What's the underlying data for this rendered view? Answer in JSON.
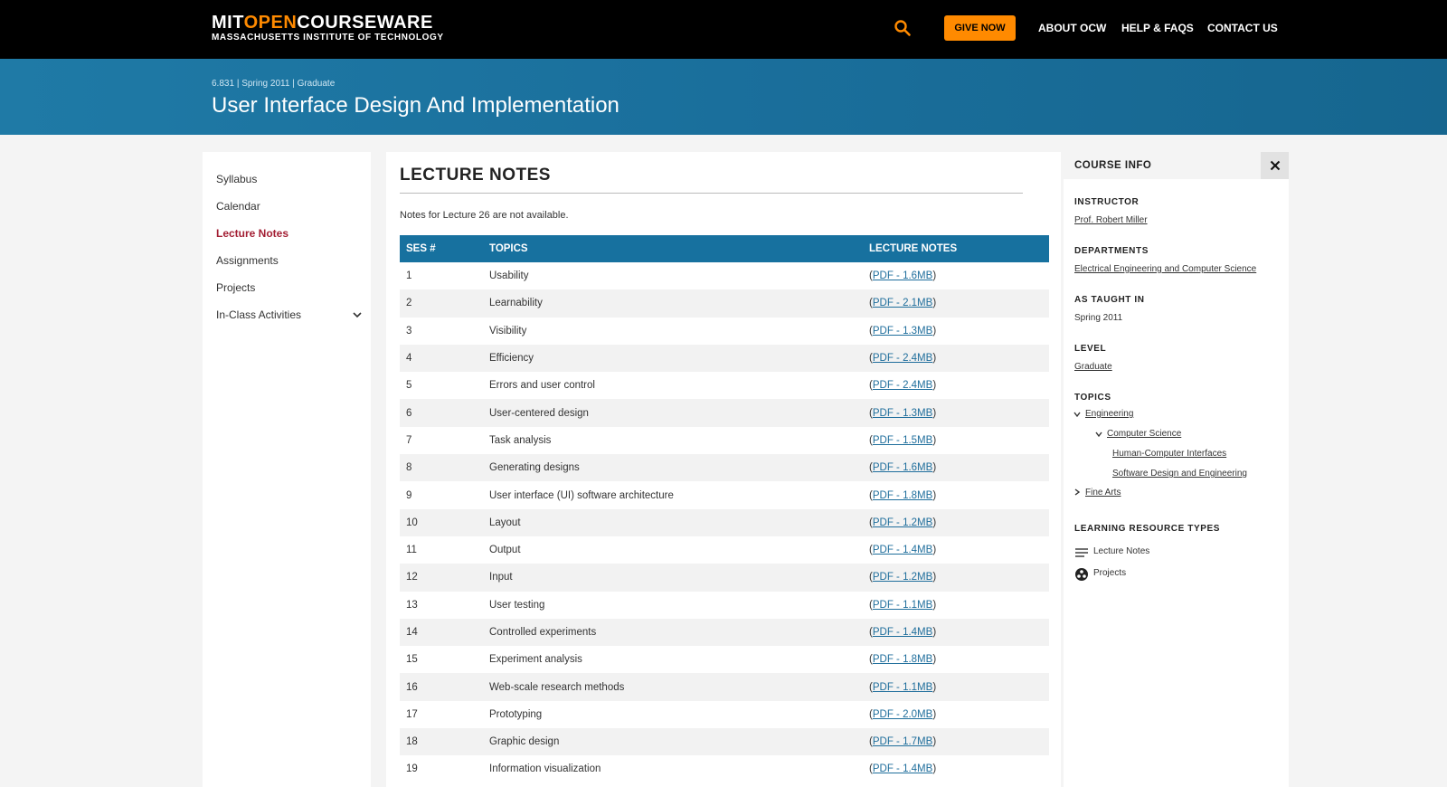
{
  "header": {
    "logo_part1": "MIT",
    "logo_part2": "OPEN",
    "logo_part3": "COURSEWARE",
    "logo_sub": "MASSACHUSETTS INSTITUTE OF TECHNOLOGY",
    "give_now": "GIVE NOW",
    "nav": [
      "ABOUT OCW",
      "HELP & FAQS",
      "CONTACT US"
    ]
  },
  "banner": {
    "number": "6.831",
    "term": "Spring 2011",
    "level": "Graduate",
    "separator": "|",
    "title": "User Interface Design And Implementation"
  },
  "leftnav": {
    "items": [
      "Syllabus",
      "Calendar",
      "Lecture Notes",
      "Assignments",
      "Projects",
      "In-Class Activities"
    ],
    "active": "Lecture Notes"
  },
  "main": {
    "title": "LECTURE NOTES",
    "note": "Notes for Lecture 26 are not available.",
    "columns": [
      "SES #",
      "TOPICS",
      "LECTURE NOTES"
    ],
    "rows": [
      {
        "ses": "1",
        "topic": "Usability",
        "link": "PDF - 1.6MB"
      },
      {
        "ses": "2",
        "topic": "Learnability",
        "link": "PDF - 2.1MB"
      },
      {
        "ses": "3",
        "topic": "Visibility",
        "link": "PDF - 1.3MB"
      },
      {
        "ses": "4",
        "topic": "Efficiency",
        "link": "PDF - 2.4MB"
      },
      {
        "ses": "5",
        "topic": "Errors and user control",
        "link": "PDF - 2.4MB"
      },
      {
        "ses": "6",
        "topic": "User-centered design",
        "link": "PDF - 1.3MB"
      },
      {
        "ses": "7",
        "topic": "Task analysis",
        "link": "PDF - 1.5MB"
      },
      {
        "ses": "8",
        "topic": "Generating designs",
        "link": "PDF - 1.6MB"
      },
      {
        "ses": "9",
        "topic": "User interface (UI) software architecture",
        "link": "PDF - 1.8MB"
      },
      {
        "ses": "10",
        "topic": "Layout",
        "link": "PDF - 1.2MB"
      },
      {
        "ses": "11",
        "topic": "Output",
        "link": "PDF - 1.4MB"
      },
      {
        "ses": "12",
        "topic": "Input",
        "link": "PDF - 1.2MB"
      },
      {
        "ses": "13",
        "topic": "User testing",
        "link": "PDF - 1.1MB"
      },
      {
        "ses": "14",
        "topic": "Controlled experiments",
        "link": "PDF - 1.4MB"
      },
      {
        "ses": "15",
        "topic": "Experiment analysis",
        "link": "PDF - 1.8MB"
      },
      {
        "ses": "16",
        "topic": "Web-scale research methods",
        "link": "PDF - 1.1MB"
      },
      {
        "ses": "17",
        "topic": "Prototyping",
        "link": "PDF - 2.0MB"
      },
      {
        "ses": "18",
        "topic": "Graphic design",
        "link": "PDF - 1.7MB"
      },
      {
        "ses": "19",
        "topic": "Information visualization",
        "link": "PDF - 1.4MB"
      }
    ]
  },
  "course_info": {
    "title": "COURSE INFO",
    "instructor_label": "INSTRUCTOR",
    "instructor": "Prof. Robert Miller",
    "departments_label": "DEPARTMENTS",
    "department": "Electrical Engineering and Computer Science",
    "taught_label": "AS TAUGHT IN",
    "taught": "Spring 2011",
    "level_label": "LEVEL",
    "level": "Graduate",
    "topics_label": "TOPICS",
    "topics": {
      "engineering": "Engineering",
      "cs": "Computer Science",
      "hci": "Human-Computer Interfaces",
      "sde": "Software Design and Engineering",
      "fine_arts": "Fine Arts"
    },
    "resources_label": "LEARNING RESOURCE TYPES",
    "resources": [
      "Lecture Notes",
      "Projects"
    ]
  },
  "colors": {
    "accent_orange": "#ff8a00",
    "banner_blue": "#1a6f9c",
    "active_red": "#a31f34"
  }
}
